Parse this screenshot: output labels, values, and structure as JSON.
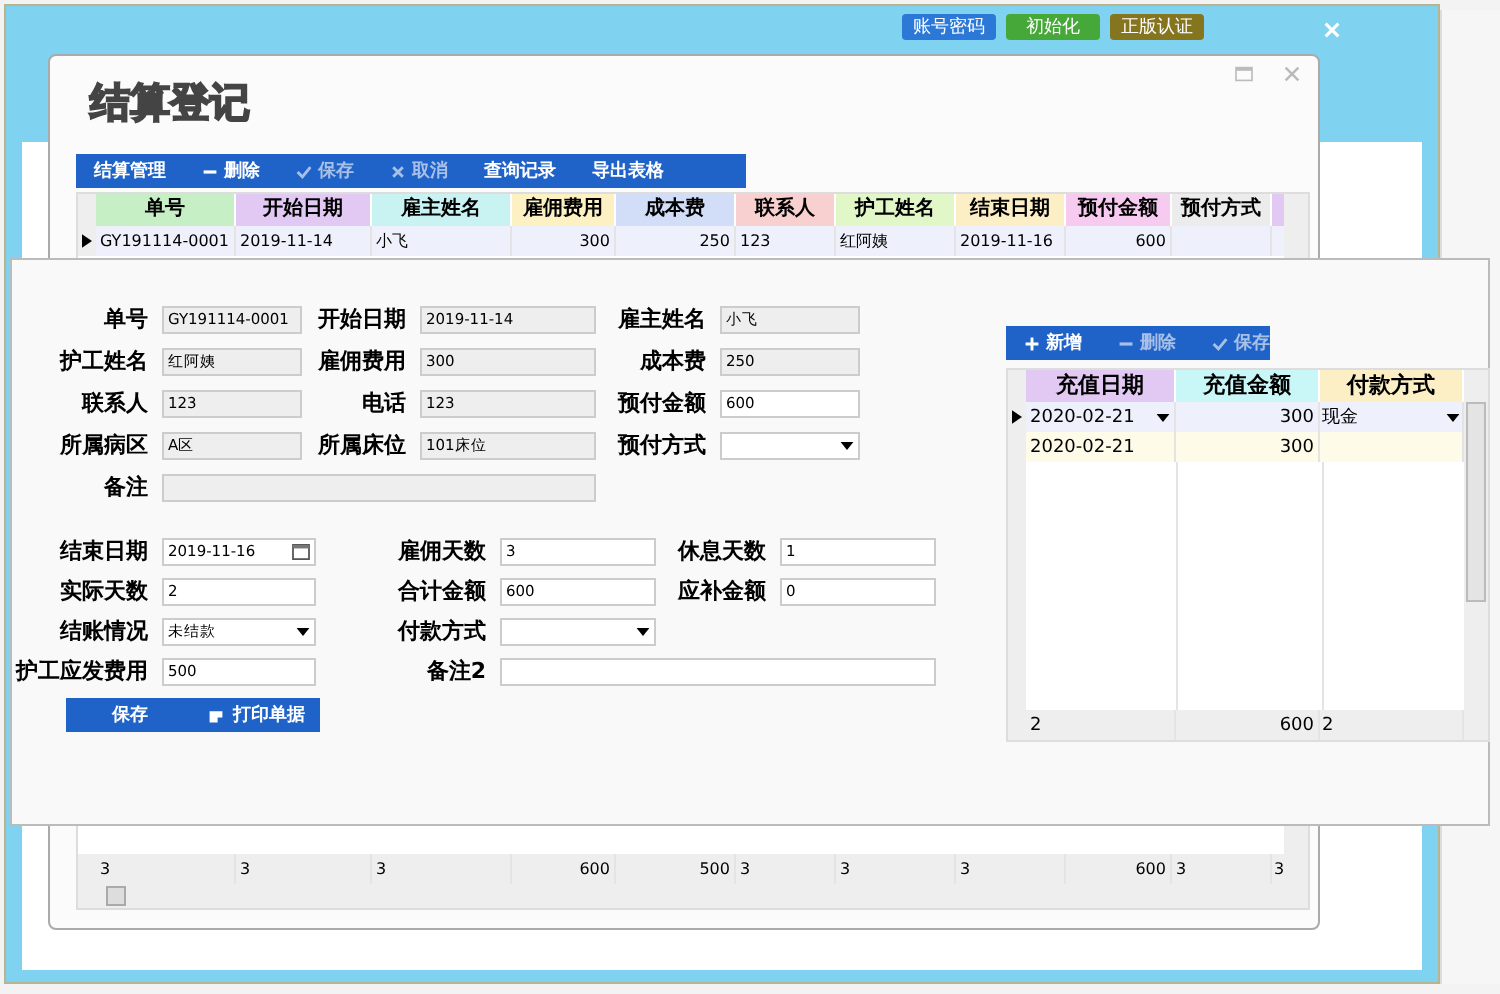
{
  "main_window": {
    "header_buttons": [
      {
        "label": "账号密码",
        "color": "#2b78d6"
      },
      {
        "label": "初始化",
        "color": "#47a83a"
      },
      {
        "label": "正版认证",
        "color": "#85751e"
      }
    ]
  },
  "dialog": {
    "title": "结算登记",
    "toolbar": [
      {
        "label": "结算管理",
        "kind": "text",
        "disabled": false
      },
      {
        "label": "删除",
        "kind": "delete",
        "disabled": false
      },
      {
        "label": "保存",
        "kind": "save",
        "disabled": true
      },
      {
        "label": "取消",
        "kind": "cancel",
        "disabled": true
      },
      {
        "label": "查询记录",
        "kind": "text",
        "disabled": false
      },
      {
        "label": "导出表格",
        "kind": "text",
        "disabled": false
      }
    ],
    "table": {
      "columns": [
        {
          "label": "单号",
          "color": "#c6efc6"
        },
        {
          "label": "开始日期",
          "color": "#e2c9f3"
        },
        {
          "label": "雇主姓名",
          "color": "#c9f3f3"
        },
        {
          "label": "雇佣费用",
          "color": "#fdf0c2"
        },
        {
          "label": "成本费",
          "color": "#d2ddf8"
        },
        {
          "label": "联系人",
          "color": "#f8d0d0"
        },
        {
          "label": "护工姓名",
          "color": "#e2f7c8"
        },
        {
          "label": "结束日期",
          "color": "#fcefc6"
        },
        {
          "label": "预付金额",
          "color": "#f7cbef"
        },
        {
          "label": "预付方式",
          "color": "#ececec"
        }
      ],
      "rows": [
        {
          "selected": true,
          "cells": [
            "GY191114-0001",
            "2019-11-14",
            "小飞",
            "300",
            "250",
            "123",
            "红阿姨",
            "2019-11-16",
            "600",
            ""
          ]
        }
      ],
      "footer": [
        "3",
        "3",
        "3",
        "600",
        "500",
        "3",
        "3",
        "3",
        "600",
        "3",
        "3"
      ]
    }
  },
  "form": {
    "upper": [
      {
        "label": "单号",
        "value": "GY191114-0001",
        "kind": "readonly"
      },
      {
        "label": "开始日期",
        "value": "2019-11-14",
        "kind": "readonly"
      },
      {
        "label": "雇主姓名",
        "value": "小飞",
        "kind": "readonly"
      },
      {
        "label": "护工姓名",
        "value": "红阿姨",
        "kind": "readonly"
      },
      {
        "label": "雇佣费用",
        "value": "300",
        "kind": "readonly"
      },
      {
        "label": "成本费",
        "value": "250",
        "kind": "readonly"
      },
      {
        "label": "联系人",
        "value": "123",
        "kind": "readonly"
      },
      {
        "label": "电话",
        "value": "123",
        "kind": "readonly"
      },
      {
        "label": "预付金额",
        "value": "600",
        "kind": "text"
      },
      {
        "label": "所属病区",
        "value": "A区",
        "kind": "readonly"
      },
      {
        "label": "所属床位",
        "value": "101床位",
        "kind": "readonly"
      },
      {
        "label": "预付方式",
        "kind": "select"
      },
      {
        "label": "备注",
        "kind": "readonly-wide"
      }
    ],
    "lower": [
      {
        "label": "结束日期",
        "value": "2019-11-16",
        "kind": "date"
      },
      {
        "label": "雇佣天数",
        "value": "3",
        "kind": "text"
      },
      {
        "label": "休息天数",
        "value": "1",
        "kind": "text"
      },
      {
        "label": "实际天数",
        "value": "2",
        "kind": "text"
      },
      {
        "label": "合计金额",
        "value": "600",
        "kind": "text"
      },
      {
        "label": "应补金额",
        "value": "0",
        "kind": "text"
      },
      {
        "label": "结账情况",
        "value": "未结款",
        "kind": "select"
      },
      {
        "label": "付款方式",
        "kind": "select"
      },
      {
        "kind": "empty"
      },
      {
        "label": "护工应发费用",
        "value": "500",
        "kind": "text"
      },
      {
        "label": "备注2",
        "kind": "text-wide"
      }
    ],
    "buttons": [
      {
        "label": "保存",
        "kind": "save"
      },
      {
        "label": "打印单据",
        "kind": "print"
      }
    ]
  },
  "recharge": {
    "toolbar": [
      {
        "label": "新增",
        "kind": "add",
        "disabled": false
      },
      {
        "label": "删除",
        "kind": "delete",
        "disabled": true
      },
      {
        "label": "保存",
        "kind": "save",
        "disabled": true
      }
    ],
    "columns": [
      {
        "label": "充值日期",
        "color": "#e2c9f3"
      },
      {
        "label": "充值金额",
        "color": "#c9f6f6"
      },
      {
        "label": "付款方式",
        "color": "#fcefc6"
      }
    ],
    "rows": [
      {
        "selected": true,
        "date": "2020-02-21",
        "amount": "300",
        "method": "现金"
      },
      {
        "selected": false,
        "date": "2020-02-21",
        "amount": "300"
      }
    ],
    "footer": [
      "2",
      "600",
      "2"
    ]
  }
}
